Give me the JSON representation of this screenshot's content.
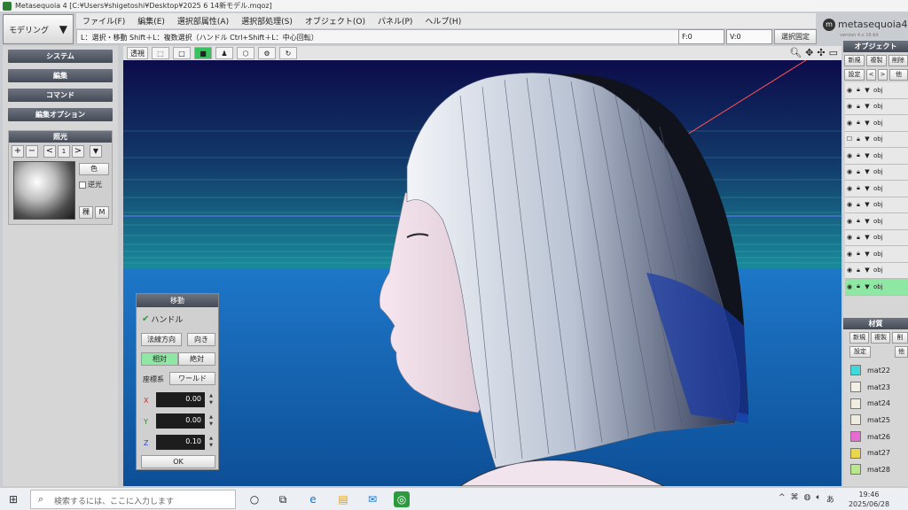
{
  "window": {
    "title": "Metasequoia 4 [C:¥Users¥shigetoshi¥Desktop¥2025 6 14新モデル.mqoz]"
  },
  "mode_selector": {
    "label": "モデリング"
  },
  "menu": {
    "items": [
      "ファイル(F)",
      "編集(E)",
      "選択部属性(A)",
      "選択部処理(S)",
      "オブジェクト(O)",
      "パネル(P)",
      "ヘルプ(H)"
    ]
  },
  "hint": "L：選択・移動 Shift＋L：複数選択（ハンドル Ctrl+Shift＋L：中心回転）",
  "coords": {
    "f": "F:0",
    "v": "V:0"
  },
  "fix_selection": "選択固定",
  "logo": {
    "symbol": "m",
    "text": "metasequoia4",
    "sub": "version 4.x  16-bit"
  },
  "left_panel": {
    "sections": [
      "システム",
      "編集",
      "コマンド",
      "編集オプション"
    ],
    "lighting": {
      "title": "照光",
      "buttons": [
        "+",
        "−",
        "<",
        "1",
        ">",
        "▼"
      ],
      "color_btn": "色",
      "backlight": "逆光",
      "mode_btn": "稞",
      "m_btn": "M"
    }
  },
  "viewport_toolbar": {
    "transparent": "透視"
  },
  "move_panel": {
    "title": "移動",
    "handle": "ハンドル",
    "normal_btn": "法線方向",
    "direction_btn": "向き",
    "relative_btn": "相対",
    "absolute_btn": "絶対",
    "coord_label": "座標系",
    "coord_value": "ワールド",
    "x_label": "X",
    "x_value": "0.00",
    "y_label": "Y",
    "y_value": "0.00",
    "z_label": "Z",
    "z_value": "0.10",
    "ok": "OK"
  },
  "object_panel": {
    "title": "オブジェクト",
    "btn_new": "新規",
    "btn_copy": "複製",
    "btn_delete": "削除",
    "btn_settings": "設定",
    "btn_prev": "<",
    "btn_next": ">",
    "btn_other": "他",
    "rows": [
      "obj",
      "obj",
      "obj",
      "obj",
      "obj",
      "obj",
      "obj",
      "obj",
      "obj",
      "obj",
      "obj",
      "obj",
      "obj"
    ]
  },
  "material_panel": {
    "title": "材質",
    "btn_new": "新規",
    "btn_copy": "複製",
    "btn_delete": "削",
    "btn_settings": "設定",
    "btn_other": "他",
    "items": [
      {
        "name": "mat22",
        "color": "#3fd9d9"
      },
      {
        "name": "mat23",
        "color": "#f3efe6"
      },
      {
        "name": "mat24",
        "color": "#f1ece2"
      },
      {
        "name": "mat25",
        "color": "#f0ebe0"
      },
      {
        "name": "mat26",
        "color": "#e86bd2"
      },
      {
        "name": "mat27",
        "color": "#e9d64a"
      },
      {
        "name": "mat28",
        "color": "#b9e88c"
      }
    ]
  },
  "taskbar": {
    "search_placeholder": "検索するには、ここに入力します",
    "ime": "あ",
    "time": "19:46",
    "date": "2025/06/28"
  },
  "colors": {
    "accent_green": "#36c35b",
    "panel_header": "#4f5560",
    "viewport_sky": "#0f1257",
    "viewport_ground": "#1467b0"
  }
}
